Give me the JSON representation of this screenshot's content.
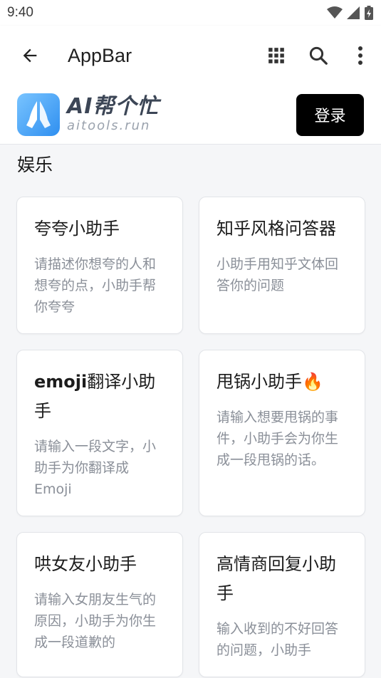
{
  "status": {
    "time": "9:40"
  },
  "appbar": {
    "title": "AppBar"
  },
  "brand": {
    "name": "AI帮个忙",
    "domain": "aitools.run"
  },
  "header": {
    "login_label": "登录"
  },
  "section": {
    "title": "娱乐"
  },
  "cards": [
    {
      "title": "夸夸小助手",
      "desc": "请描述你想夸的人和想夸的点，小助手帮你夸夸"
    },
    {
      "title": "知乎风格问答器",
      "desc": "小助手用知乎文体回答你的问题"
    },
    {
      "title_bold": "emoji",
      "title": "翻译小助手",
      "desc": "请输入一段文字，小助手为你翻译成Emoji"
    },
    {
      "title": "甩锅小助手🔥",
      "desc": "请输入想要甩锅的事件，小助手会为你生成一段甩锅的话。"
    },
    {
      "title": "哄女友小助手",
      "desc": "请输入女朋友生气的原因，小助手为你生成一段道歉的"
    },
    {
      "title": "高情商回复小助手",
      "desc": "输入收到的不好回答的问题，小助手"
    }
  ],
  "colors": {
    "accent": "#000000",
    "logo": "#2f8ff0"
  }
}
